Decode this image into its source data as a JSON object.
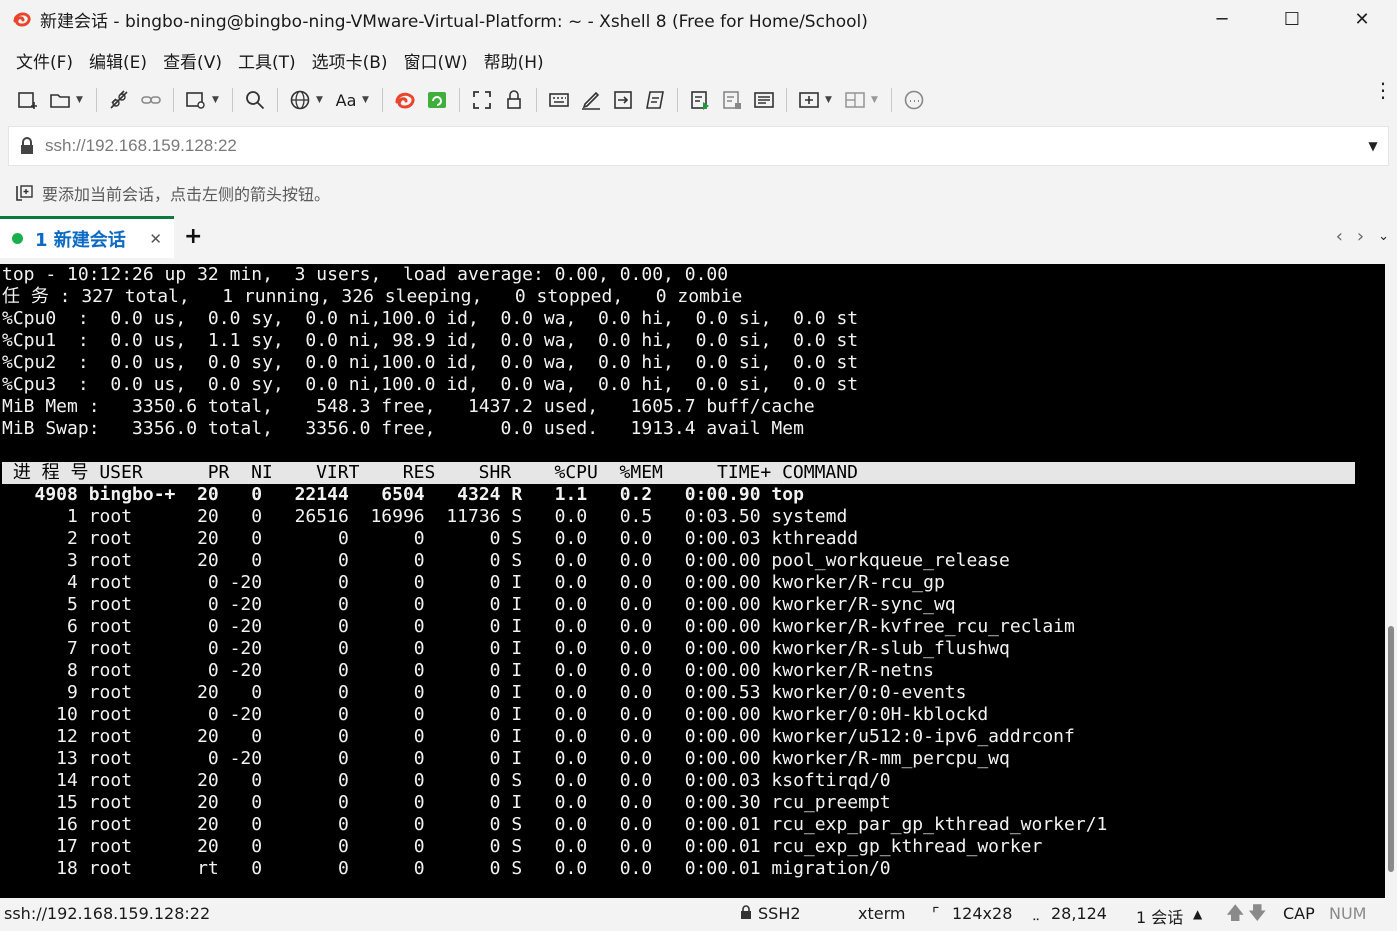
{
  "window": {
    "title": "新建会话 - bingbo-ning@bingbo-ning-VMware-Virtual-Platform: ~ - Xshell 8 (Free for Home/School)",
    "minimize": "─",
    "maximize": "☐",
    "close": "✕"
  },
  "menu": [
    "文件(F)",
    "编辑(E)",
    "查看(V)",
    "工具(T)",
    "选项卡(B)",
    "窗口(W)",
    "帮助(H)"
  ],
  "address": {
    "value": "ssh://192.168.159.128:22"
  },
  "hint": "要添加当前会话，点击左侧的箭头按钮。",
  "tab": {
    "label": "1 新建会话",
    "close": "✕",
    "add": "+"
  },
  "terminal": {
    "summary": [
      "top - 10:12:26 up 32 min,  3 users,  load average: 0.00, 0.00, 0.00",
      "任 务 : 327 total,   1 running, 326 sleeping,   0 stopped,   0 zombie",
      "%Cpu0  :  0.0 us,  0.0 sy,  0.0 ni,100.0 id,  0.0 wa,  0.0 hi,  0.0 si,  0.0 st",
      "%Cpu1  :  0.0 us,  1.1 sy,  0.0 ni, 98.9 id,  0.0 wa,  0.0 hi,  0.0 si,  0.0 st",
      "%Cpu2  :  0.0 us,  0.0 sy,  0.0 ni,100.0 id,  0.0 wa,  0.0 hi,  0.0 si,  0.0 st",
      "%Cpu3  :  0.0 us,  0.0 sy,  0.0 ni,100.0 id,  0.0 wa,  0.0 hi,  0.0 si,  0.0 st",
      "MiB Mem :   3350.6 total,    548.3 free,   1437.2 used,   1605.7 buff/cache",
      "MiB Swap:   3356.0 total,   3356.0 free,      0.0 used.   1913.4 avail Mem"
    ],
    "header": " 进 程 号 USER      PR  NI    VIRT    RES    SHR    %CPU  %MEM     TIME+ COMMAND",
    "processes": [
      "   4908 bingbo-+  20   0   22144   6504   4324 R   1.1   0.2   0:00.90 top",
      "      1 root      20   0   26516  16996  11736 S   0.0   0.5   0:03.50 systemd",
      "      2 root      20   0       0      0      0 S   0.0   0.0   0:00.03 kthreadd",
      "      3 root      20   0       0      0      0 S   0.0   0.0   0:00.00 pool_workqueue_release",
      "      4 root       0 -20       0      0      0 I   0.0   0.0   0:00.00 kworker/R-rcu_gp",
      "      5 root       0 -20       0      0      0 I   0.0   0.0   0:00.00 kworker/R-sync_wq",
      "      6 root       0 -20       0      0      0 I   0.0   0.0   0:00.00 kworker/R-kvfree_rcu_reclaim",
      "      7 root       0 -20       0      0      0 I   0.0   0.0   0:00.00 kworker/R-slub_flushwq",
      "      8 root       0 -20       0      0      0 I   0.0   0.0   0:00.00 kworker/R-netns",
      "      9 root      20   0       0      0      0 I   0.0   0.0   0:00.53 kworker/0:0-events",
      "     10 root       0 -20       0      0      0 I   0.0   0.0   0:00.00 kworker/0:0H-kblockd",
      "     12 root      20   0       0      0      0 I   0.0   0.0   0:00.00 kworker/u512:0-ipv6_addrconf",
      "     13 root       0 -20       0      0      0 I   0.0   0.0   0:00.00 kworker/R-mm_percpu_wq",
      "     14 root      20   0       0      0      0 S   0.0   0.0   0:00.03 ksoftirqd/0",
      "     15 root      20   0       0      0      0 I   0.0   0.0   0:00.30 rcu_preempt",
      "     16 root      20   0       0      0      0 S   0.0   0.0   0:00.01 rcu_exp_par_gp_kthread_worker/1",
      "     17 root      20   0       0      0      0 S   0.0   0.0   0:00.01 rcu_exp_gp_kthread_worker",
      "     18 root      rt   0       0      0      0 S   0.0   0.0   0:00.01 migration/0"
    ]
  },
  "status": {
    "connection": "ssh://192.168.159.128:22",
    "protocol": "SSH2",
    "term": "xterm",
    "size": "124x28",
    "cursor": "28,124",
    "sessions": "1 会话",
    "cap": "CAP",
    "num": "NUM"
  }
}
